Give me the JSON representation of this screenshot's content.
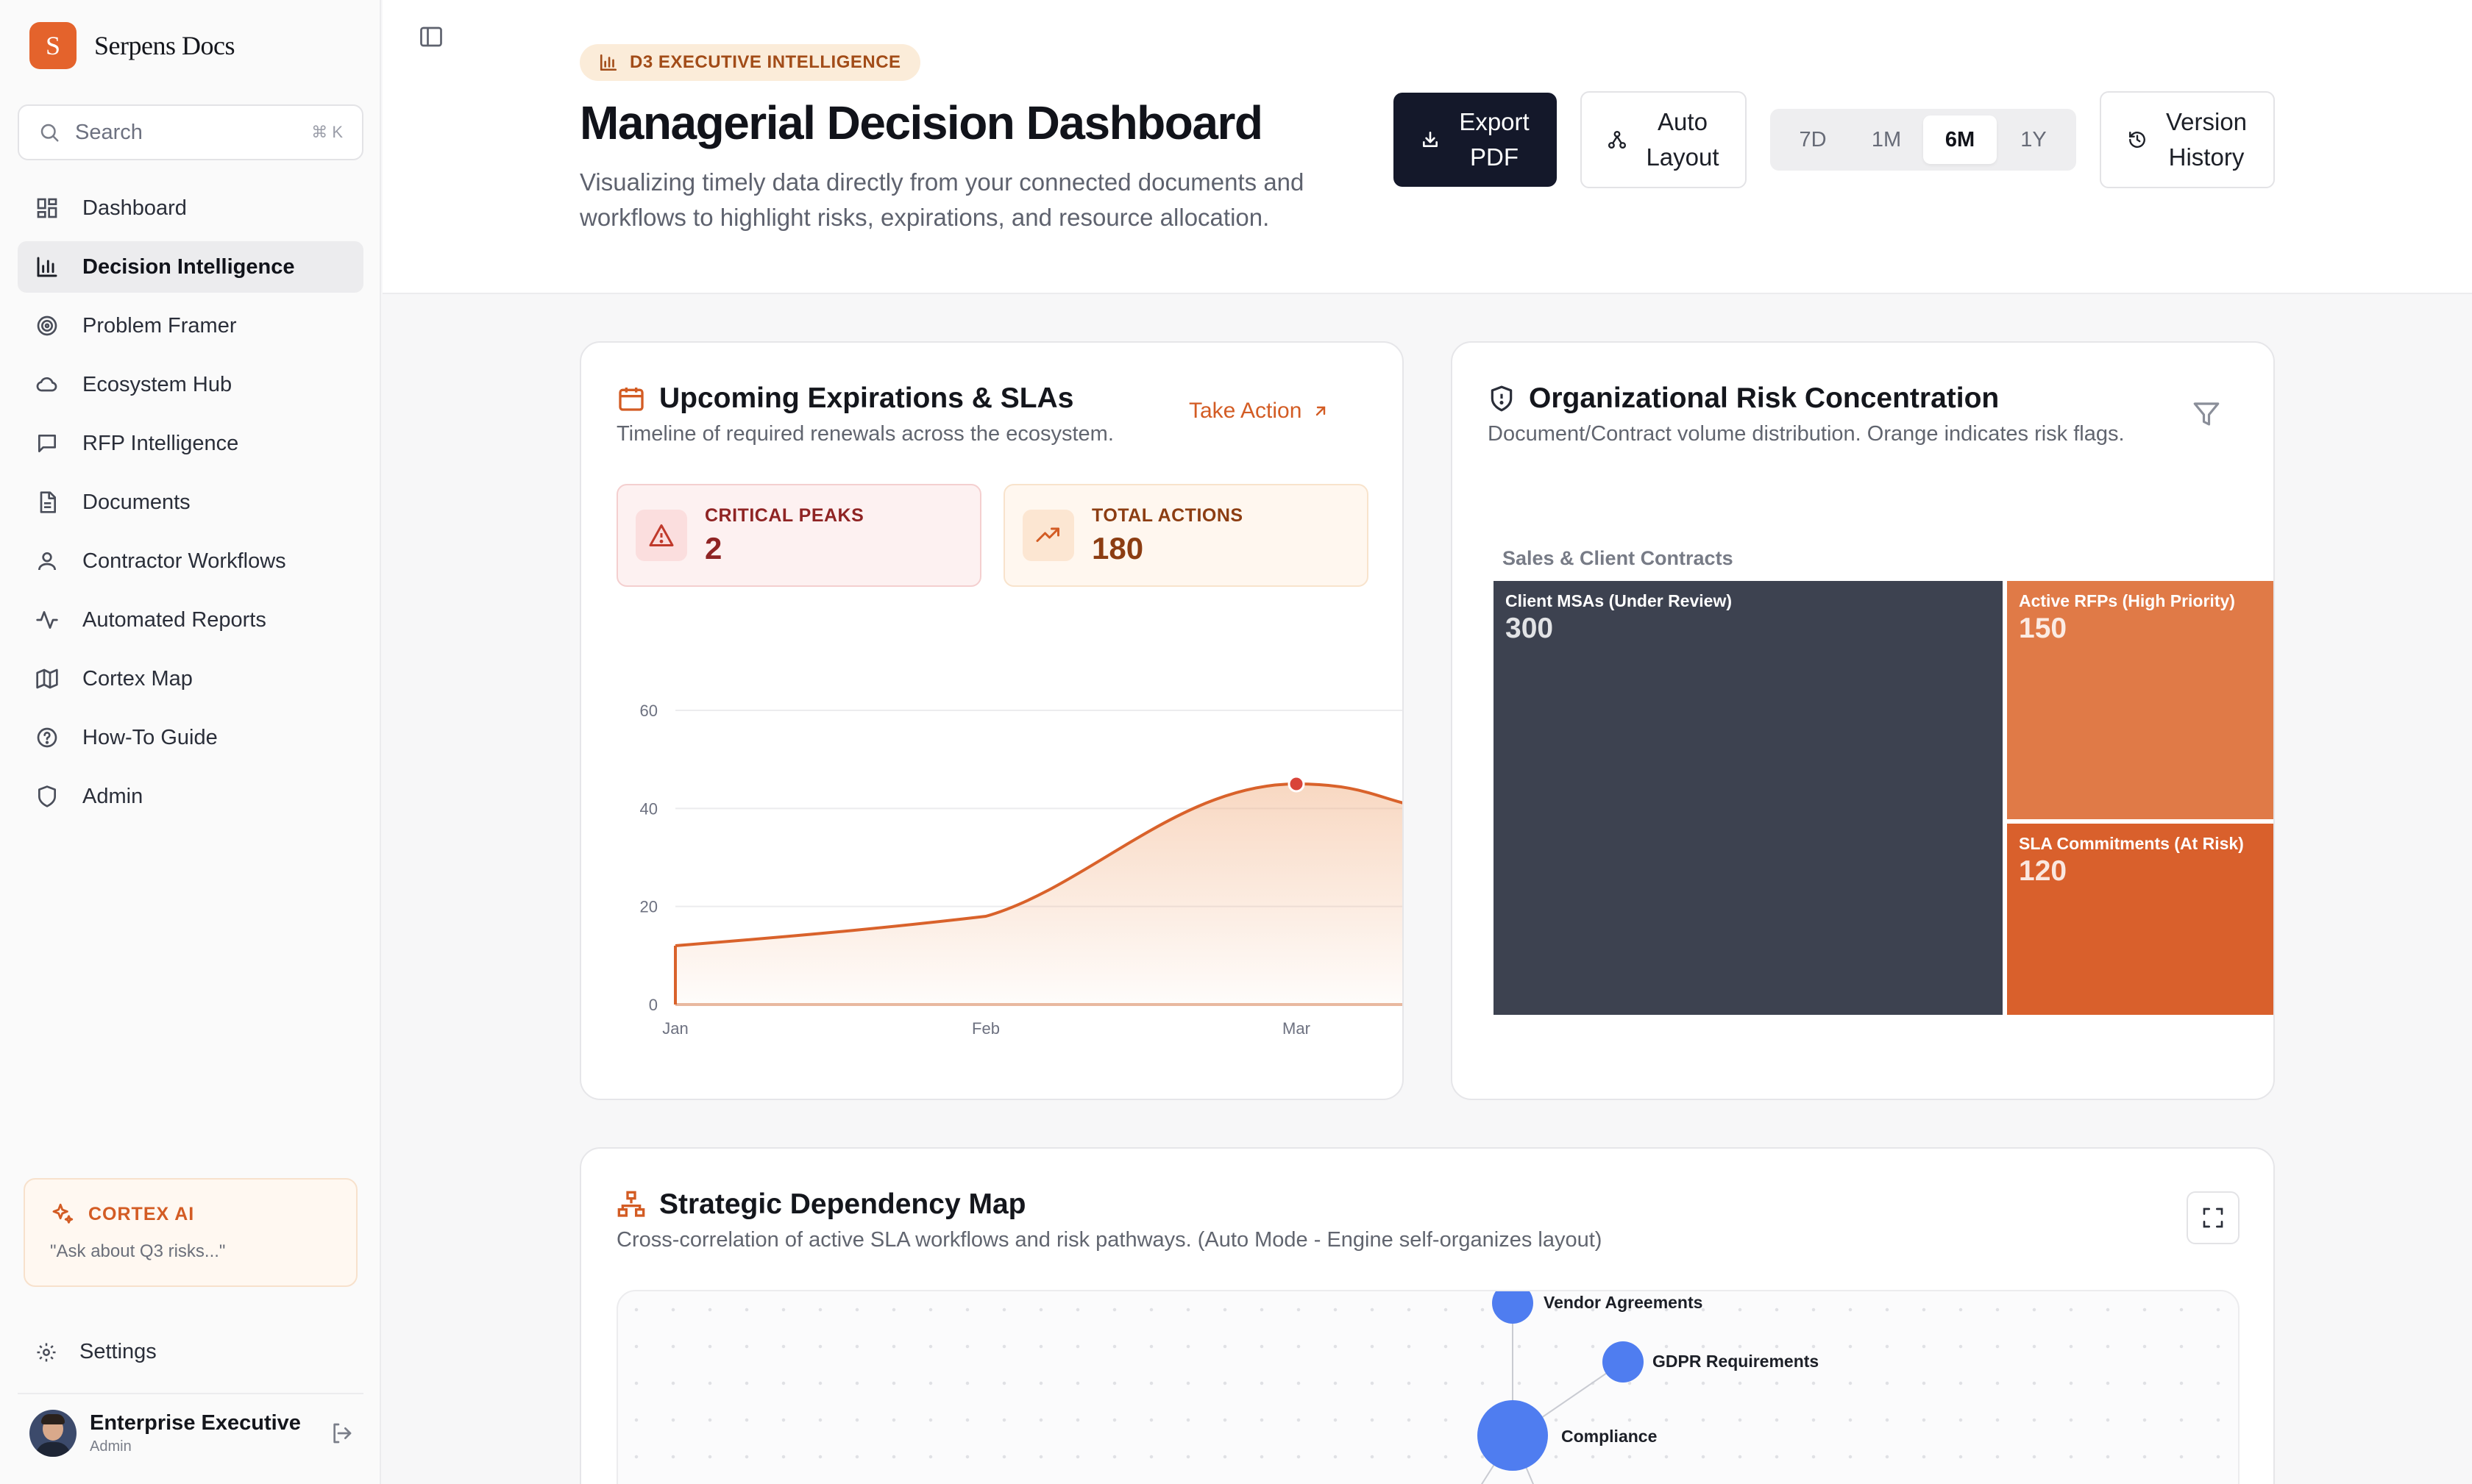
{
  "brand": {
    "logo_letter": "S",
    "name": "Serpens Docs"
  },
  "search": {
    "placeholder": "Search",
    "shortcut": "⌘ K"
  },
  "sidebar": {
    "items": [
      {
        "label": "Dashboard",
        "icon": "grid-icon",
        "active": false
      },
      {
        "label": "Decision Intelligence",
        "icon": "bar-chart-icon",
        "active": true
      },
      {
        "label": "Problem Framer",
        "icon": "target-icon",
        "active": false
      },
      {
        "label": "Ecosystem Hub",
        "icon": "cloud-icon",
        "active": false
      },
      {
        "label": "RFP Intelligence",
        "icon": "message-square-icon",
        "active": false
      },
      {
        "label": "Documents",
        "icon": "file-text-icon",
        "active": false
      },
      {
        "label": "Contractor Workflows",
        "icon": "user-icon",
        "active": false
      },
      {
        "label": "Automated Reports",
        "icon": "activity-icon",
        "active": false
      },
      {
        "label": "Cortex Map",
        "icon": "map-icon",
        "active": false
      },
      {
        "label": "How-To Guide",
        "icon": "help-circle-icon",
        "active": false
      },
      {
        "label": "Admin",
        "icon": "shield-icon",
        "active": false
      }
    ]
  },
  "cortex": {
    "title": "CORTEX AI",
    "prompt": "\"Ask about Q3 risks...\""
  },
  "settings": {
    "label": "Settings"
  },
  "user": {
    "name": "Enterprise Executive",
    "role": "Admin"
  },
  "header": {
    "badge": "D3 EXECUTIVE INTELLIGENCE",
    "title": "Managerial Decision Dashboard",
    "subtitle": "Visualizing timely data directly from your connected documents and workflows to highlight risks, expirations, and resource allocation.",
    "export_line1": "Export",
    "export_line2": "PDF",
    "auto_line1": "Auto",
    "auto_line2": "Layout",
    "ranges": [
      "7D",
      "1M",
      "6M",
      "1Y"
    ],
    "selected_range": "6M",
    "version_line1": "Version",
    "version_line2": "History"
  },
  "expirations": {
    "title": "Upcoming Expirations & SLAs",
    "subtitle": "Timeline of required renewals across the ecosystem.",
    "action": "Take Action",
    "critical_label": "CRITICAL PEAKS",
    "critical_value": "2",
    "total_label": "TOTAL ACTIONS",
    "total_value": "180"
  },
  "risk": {
    "title": "Organizational Risk Concentration",
    "subtitle": "Document/Contract volume distribution. Orange indicates risk flags."
  },
  "dependency": {
    "title": "Strategic Dependency Map",
    "subtitle": "Cross-correlation of active SLA workflows and risk pathways. (Auto Mode - Engine self-organizes layout)",
    "nodes": [
      "Vendor Agreements",
      "GDPR Requirements",
      "Compliance"
    ]
  },
  "chart_data": [
    {
      "type": "area",
      "title": "",
      "x": [
        "Jan",
        "Feb",
        "Mar"
      ],
      "y_ticks": [
        0,
        20,
        40,
        60
      ],
      "ylim": [
        0,
        60
      ],
      "series": [
        {
          "values": [
            12,
            18,
            45
          ]
        }
      ],
      "highlight_point": {
        "x": "Mar",
        "y": 45
      },
      "color": "#d9622b",
      "grid": true
    },
    {
      "type": "treemap",
      "group": "Sales & Client Contracts",
      "items": [
        {
          "name": "Client MSAs (Under Review)",
          "value": 300,
          "color": "#3d4250"
        },
        {
          "name": "Active RFPs (High Priority)",
          "value": 150,
          "color": "#e07a47"
        },
        {
          "name": "SLA Commitments (At Risk)",
          "value": 120,
          "color": "#d9602c"
        }
      ]
    }
  ]
}
